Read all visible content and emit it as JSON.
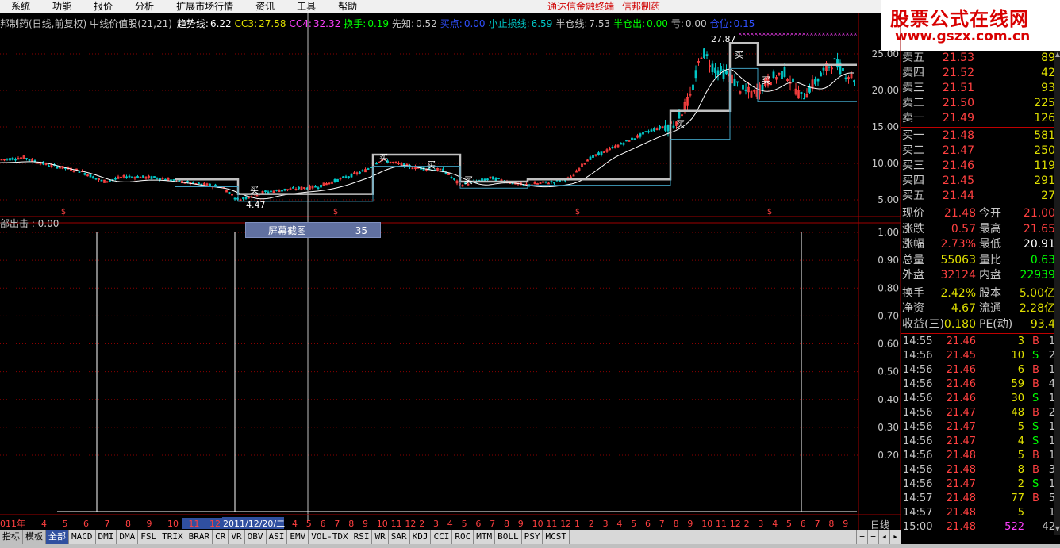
{
  "menu": [
    "系统",
    "功能",
    "报价",
    "分析",
    "扩展市场行情",
    "资讯",
    "工具",
    "帮助"
  ],
  "center_links": [
    "通达信金融终端",
    "信邦制药"
  ],
  "logo": {
    "title": "股票公式在线网",
    "url": "www.gszx.com.cn"
  },
  "header": {
    "name": "邦制药(日线,前复权)",
    "indicator": "中线价值股(21,21)",
    "items": [
      {
        "label": "趋势线:",
        "value": "6.22",
        "color": "#ffffff"
      },
      {
        "label": "CC3:",
        "value": "27.58",
        "color": "#e0e000"
      },
      {
        "label": "CC4:",
        "value": "32.32",
        "color": "#ff40ff"
      },
      {
        "label": "换手:",
        "value": "0.19",
        "color": "#00ff00"
      },
      {
        "label": "先知:",
        "value": "0.52",
        "color": "#c8c8c8"
      },
      {
        "label": "买点:",
        "value": "0.00",
        "color": "#3050ff"
      },
      {
        "label": "小止损线:",
        "value": "6.59",
        "color": "#00c8c8"
      },
      {
        "label": "半仓线:",
        "value": "7.53",
        "color": "#c8c8c8"
      },
      {
        "label": "半仓出:",
        "value": "0.00",
        "color": "#00ff00"
      },
      {
        "label": "亏:",
        "value": "0.00",
        "color": "#c8c8c8"
      },
      {
        "label": "仓位:",
        "value": "0.15",
        "color": "#3050ff"
      }
    ]
  },
  "chart_labels": {
    "high": "27.87",
    "low": "4.47",
    "buy": "买"
  },
  "sub_label": "部出击 : 0.00",
  "tooltip": {
    "label": "屏幕截图",
    "value": "35"
  },
  "y_axis_main": [
    "25.00",
    "20.00",
    "15.00",
    "10.00",
    "5.00"
  ],
  "y_axis_sub": [
    "1.00",
    "0.90",
    "0.80",
    "0.70",
    "0.60",
    "0.50",
    "0.40",
    "0.30",
    "0.20"
  ],
  "x_axis": {
    "start": "011年",
    "ticks": [
      "4",
      "5",
      "6",
      "7",
      "8",
      "9",
      "10",
      "11",
      "12",
      "2011/12/20/二",
      "4",
      "5",
      "6",
      "7",
      "8",
      "9",
      "10",
      "11",
      "12",
      "2",
      "3",
      "4",
      "5",
      "6",
      "7",
      "8",
      "9",
      "10",
      "11",
      "12",
      "1",
      "2",
      "3",
      "4",
      "5",
      "6",
      "7",
      "8",
      "9",
      "10",
      "11",
      "12",
      "2",
      "3",
      "4",
      "5",
      "6",
      "7",
      "8",
      "9",
      "10",
      "11"
    ],
    "period": "日线"
  },
  "order_book": {
    "asks": [
      {
        "label": "卖五",
        "price": "21.53",
        "vol": "89"
      },
      {
        "label": "卖四",
        "price": "21.52",
        "vol": "42"
      },
      {
        "label": "卖三",
        "price": "21.51",
        "vol": "93"
      },
      {
        "label": "卖二",
        "price": "21.50",
        "vol": "225"
      },
      {
        "label": "卖一",
        "price": "21.49",
        "vol": "126"
      }
    ],
    "bids": [
      {
        "label": "买一",
        "price": "21.48",
        "vol": "581"
      },
      {
        "label": "买二",
        "price": "21.47",
        "vol": "250"
      },
      {
        "label": "买三",
        "price": "21.46",
        "vol": "119"
      },
      {
        "label": "买四",
        "price": "21.45",
        "vol": "291"
      },
      {
        "label": "买五",
        "price": "21.44",
        "vol": "27"
      }
    ]
  },
  "quote": [
    {
      "l1": "现价",
      "v1": "21.48",
      "c1": "#ff4040",
      "l2": "今开",
      "v2": "21.00",
      "c2": "#ff4040"
    },
    {
      "l1": "涨跌",
      "v1": "0.57",
      "c1": "#ff4040",
      "l2": "最高",
      "v2": "21.65",
      "c2": "#ff4040"
    },
    {
      "l1": "涨幅",
      "v1": "2.73%",
      "c1": "#ff4040",
      "l2": "最低",
      "v2": "20.91",
      "c2": "#ffffff"
    },
    {
      "l1": "总量",
      "v1": "55063",
      "c1": "#e0e000",
      "l2": "量比",
      "v2": "0.63",
      "c2": "#00ff00"
    },
    {
      "l1": "外盘",
      "v1": "32124",
      "c1": "#ff4040",
      "l2": "内盘",
      "v2": "22939",
      "c2": "#00ff00"
    }
  ],
  "quote2": [
    {
      "l1": "换手",
      "v1": "2.42%",
      "c1": "#e0e000",
      "l2": "股本",
      "v2": "5.00亿",
      "c2": "#e0e000"
    },
    {
      "l1": "净资",
      "v1": "4.67",
      "c1": "#e0e000",
      "l2": "流通",
      "v2": "2.28亿",
      "c2": "#e0e000"
    },
    {
      "l1": "收益(三)",
      "v1": "0.180",
      "c1": "#e0e000",
      "l2": "PE(动)",
      "v2": "93.4",
      "c2": "#e0e000"
    }
  ],
  "ticks": [
    {
      "t": "14:55",
      "p": "21.46",
      "v": "3",
      "d": "B",
      "n": "1"
    },
    {
      "t": "14:56",
      "p": "21.45",
      "v": "10",
      "d": "S",
      "n": "2"
    },
    {
      "t": "14:56",
      "p": "21.46",
      "v": "6",
      "d": "B",
      "n": "1"
    },
    {
      "t": "14:56",
      "p": "21.46",
      "v": "59",
      "d": "B",
      "n": "4"
    },
    {
      "t": "14:56",
      "p": "21.46",
      "v": "30",
      "d": "S",
      "n": "1"
    },
    {
      "t": "14:56",
      "p": "21.47",
      "v": "48",
      "d": "B",
      "n": "2"
    },
    {
      "t": "14:56",
      "p": "21.47",
      "v": "5",
      "d": "S",
      "n": "1"
    },
    {
      "t": "14:56",
      "p": "21.47",
      "v": "4",
      "d": "S",
      "n": "1"
    },
    {
      "t": "14:56",
      "p": "21.48",
      "v": "5",
      "d": "B",
      "n": "1"
    },
    {
      "t": "14:56",
      "p": "21.48",
      "v": "8",
      "d": "B",
      "n": "3"
    },
    {
      "t": "14:56",
      "p": "21.47",
      "v": "2",
      "d": "S",
      "n": "1"
    },
    {
      "t": "14:57",
      "p": "21.48",
      "v": "77",
      "d": "B",
      "n": "5"
    },
    {
      "t": "14:57",
      "p": "21.48",
      "v": "5",
      "d": "",
      "n": "1"
    },
    {
      "t": "15:00",
      "p": "21.48",
      "v": "522",
      "d": "",
      "n": "42"
    }
  ],
  "tabs": [
    "指标",
    "模板",
    "全部",
    "MACD",
    "DMI",
    "DMA",
    "FSL",
    "TRIX",
    "BRAR",
    "CR",
    "VR",
    "OBV",
    "ASI",
    "EMV",
    "VOL-TDX",
    "RSI",
    "WR",
    "SAR",
    "KDJ",
    "CCI",
    "ROC",
    "MTM",
    "BOLL",
    "PSY",
    "MCST"
  ],
  "colors": {
    "up": "#ff4040",
    "down": "#00c8c8",
    "grid": "#8b0000",
    "accent": "#3050a0"
  }
}
